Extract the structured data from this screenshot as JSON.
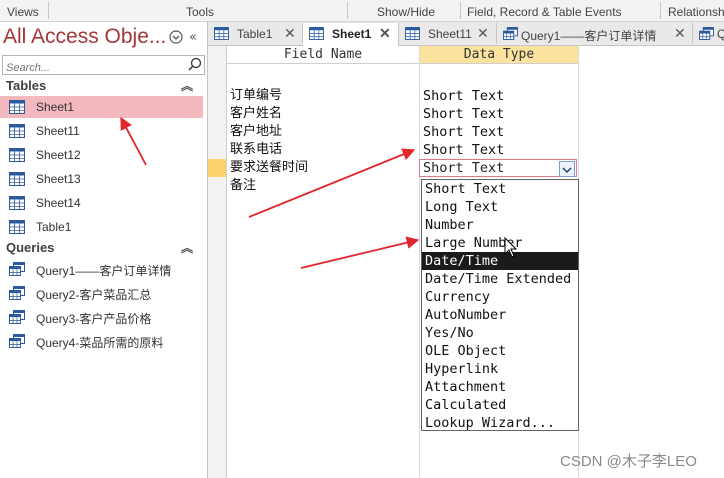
{
  "ribbon": {
    "groups": [
      "Views",
      "Tools",
      "Show/Hide",
      "Field, Record & Table Events",
      "Relationships"
    ]
  },
  "nav": {
    "title": "All Access Obje...",
    "search_placeholder": "Search...",
    "sections": [
      {
        "label": "Tables",
        "items": [
          {
            "label": "Sheet1",
            "selected": true
          },
          {
            "label": "Sheet11"
          },
          {
            "label": "Sheet12"
          },
          {
            "label": "Sheet13"
          },
          {
            "label": "Sheet14"
          },
          {
            "label": "Table1"
          }
        ]
      },
      {
        "label": "Queries",
        "items": [
          {
            "label": "Query1——客户订单详情"
          },
          {
            "label": "Query2-客户菜品汇总"
          },
          {
            "label": "Query3-客户产品价格"
          },
          {
            "label": "Query4-菜品所需的原料"
          }
        ]
      }
    ]
  },
  "tabs": [
    {
      "label": "Table1",
      "active": false
    },
    {
      "label": "Sheet1",
      "active": true
    },
    {
      "label": "Sheet11",
      "active": false
    },
    {
      "label": "Query1——客户订单详情",
      "active": false
    },
    {
      "label": "Q",
      "active": false
    }
  ],
  "design": {
    "headers": {
      "field_name": "Field Name",
      "data_type": "Data Type"
    },
    "rows": [
      {
        "field": "订单编号",
        "type": "Short Text"
      },
      {
        "field": "客户姓名",
        "type": "Short Text"
      },
      {
        "field": "客户地址",
        "type": "Short Text"
      },
      {
        "field": "联系电话",
        "type": "Short Text"
      },
      {
        "field": "要求送餐时间",
        "type": "Short Text",
        "current": true
      },
      {
        "field": "备注",
        "type": ""
      }
    ]
  },
  "dropdown": {
    "options": [
      "Short Text",
      "Long Text",
      "Number",
      "Large Number",
      "Date/Time",
      "Date/Time Extended",
      "Currency",
      "AutoNumber",
      "Yes/No",
      "OLE Object",
      "Hyperlink",
      "Attachment",
      "Calculated",
      "Lookup Wizard..."
    ],
    "highlighted_index": 4
  },
  "watermark": "CSDN @木子李LEO",
  "colors": {
    "accent": "#a4373a",
    "selected_item": "#f4b9bf",
    "header_active": "#fbe39f",
    "arrow": "#e0262b"
  }
}
